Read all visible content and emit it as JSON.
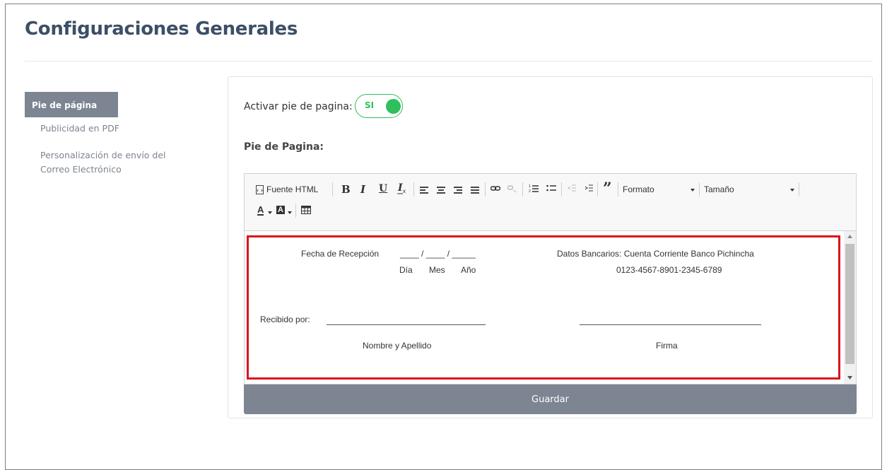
{
  "page": {
    "title": "Configuraciones Generales"
  },
  "sidebar": {
    "items": [
      {
        "label": "Pie de página",
        "active": true
      },
      {
        "label": "Publicidad en PDF",
        "active": false
      },
      {
        "label": "Personalización de envío del",
        "label2": "Correo Electrónico",
        "active": false
      }
    ]
  },
  "settings": {
    "activar_label": "Activar pie de pagina:",
    "toggle_value": "SI",
    "toggle_on": true,
    "pie_label": "Pie de Pagina:"
  },
  "toolbar": {
    "source_label": "Fuente HTML",
    "bold": "B",
    "italic": "I",
    "underline": "U",
    "remove_format": "Ix",
    "format_label": "Formato",
    "size_label": "Tamaño",
    "text_color": "A",
    "bg_color": "A"
  },
  "content": {
    "fecha_label": "Fecha de Recepción",
    "fecha_blanks": "____ / ____ / _____",
    "dia": "Día",
    "mes": "Mes",
    "anio": "Año",
    "bank_line1": "Datos Bancarios: Cuenta Corriente Banco Pichincha",
    "bank_line2": "0123-4567-8901-2345-6789",
    "recibido_label": "Recibido por:",
    "nombre_label": "Nombre y Apellido",
    "firma_label": "Firma"
  },
  "actions": {
    "save_label": "Guardar"
  },
  "colors": {
    "accent": "#2fbf5d",
    "button": "#7c8591",
    "title": "#3c4f67",
    "highlight": "#d9141c"
  }
}
